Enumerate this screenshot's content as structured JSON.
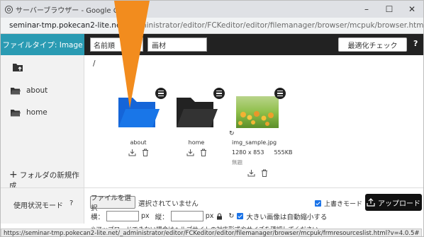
{
  "window": {
    "title": "サーバーブラウザー - Google Chrome",
    "url_host": "seminar-tmp.pokecan2-lite.net",
    "url_path": "/_administrator/editor/FCKeditor/editor/filemanager/browser/mcpuk/browser.html?Type=Image&Connector=con..."
  },
  "toolbar": {
    "filetype_label": "ファイルタイプ: Image",
    "sort_value": "名前順",
    "filter_value": "画材",
    "optimize_button": "最適化チェック",
    "help": "?"
  },
  "sidebar": {
    "items": [
      {
        "label": "about"
      },
      {
        "label": "home"
      }
    ],
    "new_folder": "フォルダの新規作成"
  },
  "main": {
    "breadcrumb": "/",
    "folders": [
      {
        "name": "about",
        "color": "#1565d8"
      },
      {
        "name": "home",
        "color": "#222222"
      }
    ],
    "image": {
      "name": "img_sample.jpg",
      "dimensions": "1280 x 853",
      "size": "555KB",
      "description": "無題"
    }
  },
  "bottom": {
    "usage_label": "使用状況モード",
    "usage_help": "?",
    "choose_file": "ファイルを選択",
    "no_file": "選択されていません",
    "overwrite_label": "上書きモード",
    "upload_button": "アップロード",
    "width_label": "横：",
    "px1": "px",
    "height_label": "縦：",
    "px2": "px",
    "resize_label": "大きい画像は自動縮小する",
    "note": "※アップロードできない場合はヘルプサイトの対応形式やサイズを確認してください。"
  },
  "status_url": "https://seminar-tmp.pokecan2-lite.net/_administrator/editor/FCKeditor/editor/filemanager/browser/mcpuk/frmresourceslist.html?v=4.0.5#",
  "colors": {
    "accent": "#2a9bb3",
    "toolbar_bg": "#222222",
    "pointer": "#f28c1e",
    "checkbox": "#1a73e8"
  }
}
